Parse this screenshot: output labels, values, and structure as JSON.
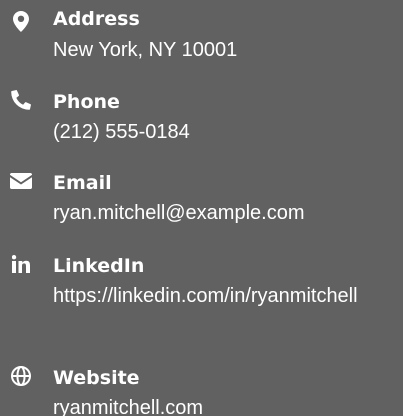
{
  "contacts": [
    {
      "label": "Address",
      "value": "New York, NY 10001",
      "icon": "map-marker-icon"
    },
    {
      "label": "Phone",
      "value": "(212) 555-0184",
      "icon": "phone-icon"
    },
    {
      "label": "Email",
      "value": "ryan.mitchell@example.com",
      "icon": "envelope-icon"
    },
    {
      "label": "LinkedIn",
      "value": "https://linkedin.com/in/ryanmitchell",
      "icon": "linkedin-icon"
    },
    {
      "label": "Website",
      "value": "ryanmitchell.com",
      "icon": "globe-icon"
    }
  ],
  "colors": {
    "background": "#616161",
    "text": "#ffffff"
  }
}
